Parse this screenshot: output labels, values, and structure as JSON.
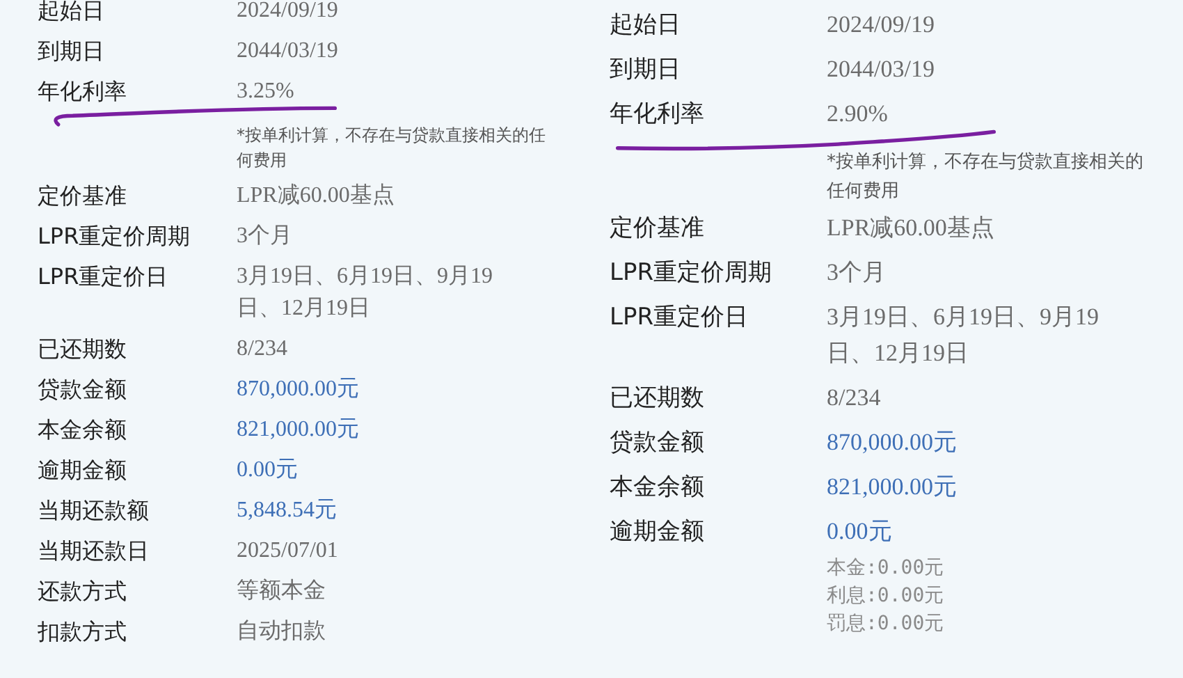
{
  "panels": [
    {
      "rows": [
        {
          "label": "起始日",
          "value": "2024/09/19",
          "kind": "text"
        },
        {
          "label": "到期日",
          "value": "2044/03/19",
          "kind": "text"
        },
        {
          "label": "年化利率",
          "value": "3.25%",
          "kind": "text",
          "underlined": true,
          "note": "*按单利计算，不存在与贷款直接相关的任何费用"
        },
        {
          "label": "定价基准",
          "value": "LPR减60.00基点",
          "kind": "text"
        },
        {
          "label": "LPR重定价周期",
          "value": "3个月",
          "kind": "text"
        },
        {
          "label": "LPR重定价日",
          "value": "3月19日、6月19日、9月19日、12月19日",
          "kind": "text"
        },
        {
          "label": "已还期数",
          "value": "8/234",
          "kind": "text"
        },
        {
          "label": "贷款金额",
          "value": "870,000.00元",
          "kind": "amount"
        },
        {
          "label": "本金余额",
          "value": "821,000.00元",
          "kind": "amount"
        },
        {
          "label": "逾期金额",
          "value": "0.00元",
          "kind": "amount"
        },
        {
          "label": "当期还款额",
          "value": "5,848.54元",
          "kind": "amount"
        },
        {
          "label": "当期还款日",
          "value": "2025/07/01",
          "kind": "text"
        },
        {
          "label": "还款方式",
          "value": "等额本金",
          "kind": "text"
        },
        {
          "label": "扣款方式",
          "value": "自动扣款",
          "kind": "text"
        }
      ]
    },
    {
      "rows": [
        {
          "label": "起始日",
          "value": "2024/09/19",
          "kind": "text"
        },
        {
          "label": "到期日",
          "value": "2044/03/19",
          "kind": "text"
        },
        {
          "label": "年化利率",
          "value": "2.90%",
          "kind": "text",
          "underlined": true,
          "note": "*按单利计算，不存在与贷款直接相关的任何费用"
        },
        {
          "label": "定价基准",
          "value": "LPR减60.00基点",
          "kind": "text"
        },
        {
          "label": "LPR重定价周期",
          "value": "3个月",
          "kind": "text"
        },
        {
          "label": "LPR重定价日",
          "value": "3月19日、6月19日、9月19日、12月19日",
          "kind": "text"
        },
        {
          "label": "已还期数",
          "value": "8/234",
          "kind": "text"
        },
        {
          "label": "贷款金额",
          "value": "870,000.00元",
          "kind": "amount"
        },
        {
          "label": "本金余额",
          "value": "821,000.00元",
          "kind": "amount"
        },
        {
          "label": "逾期金额",
          "value": "0.00元",
          "kind": "amount",
          "breakdown": [
            "本金:0.00元",
            "利息:0.00元",
            "罚息:0.00元"
          ]
        }
      ]
    }
  ]
}
